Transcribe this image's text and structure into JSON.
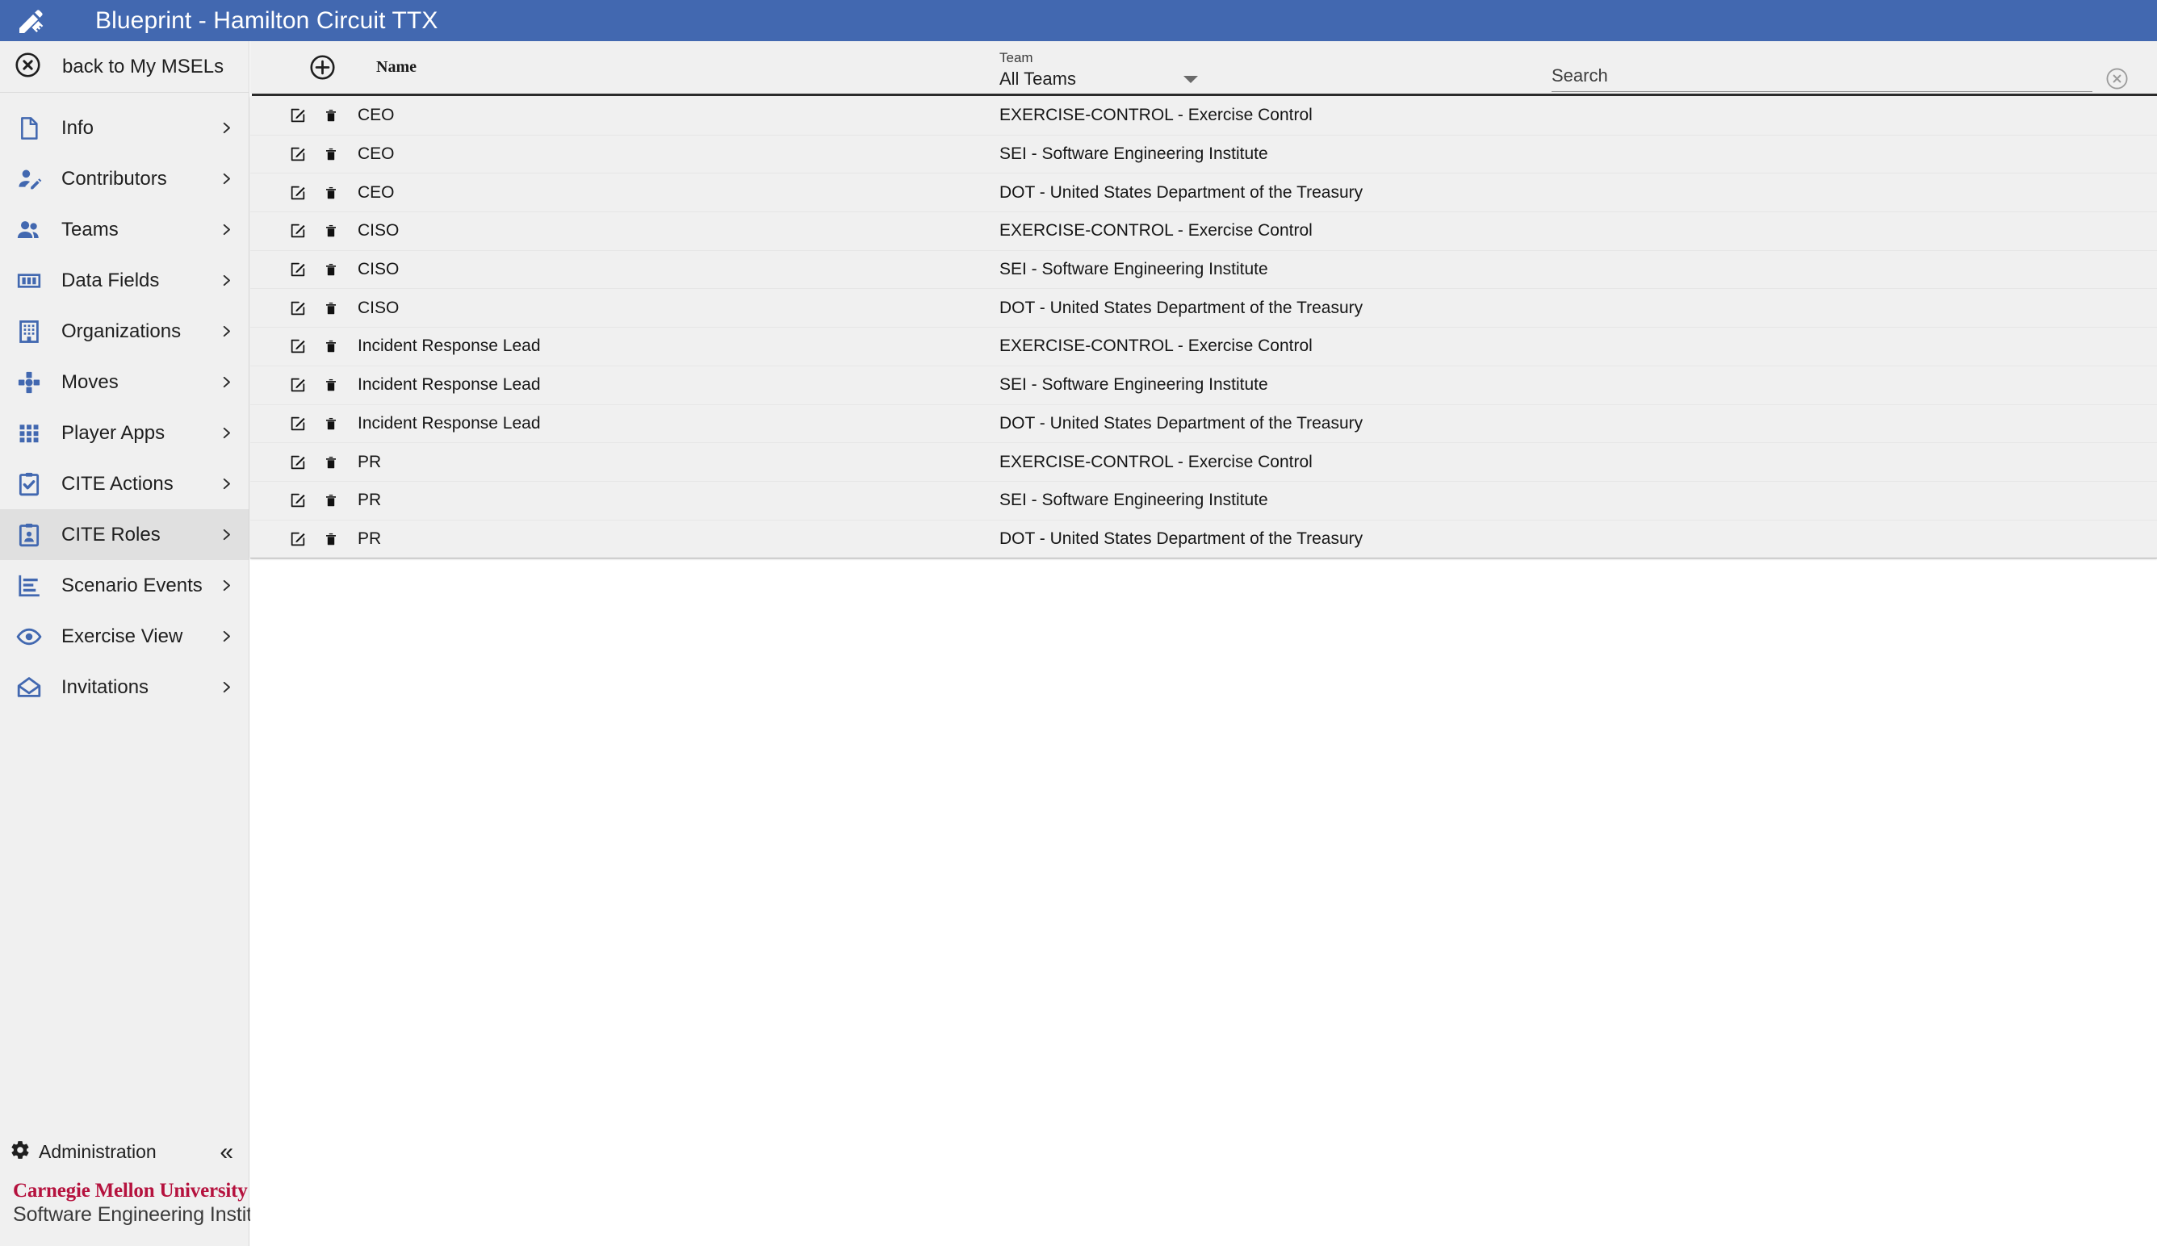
{
  "app": {
    "title": "Blueprint - Hamilton Circuit TTX",
    "logo_icon": "blueprint-pencil-ruler-icon",
    "accent_color": "#4268B0",
    "brand_color": "#B5123E"
  },
  "sidebar": {
    "back": {
      "label": "back to My MSELs",
      "icon": "circle-x-icon"
    },
    "items": [
      {
        "label": "Info",
        "icon": "document-icon",
        "selected": false
      },
      {
        "label": "Contributors",
        "icon": "user-edit-icon",
        "selected": false
      },
      {
        "label": "Teams",
        "icon": "people-icon",
        "selected": false
      },
      {
        "label": "Data Fields",
        "icon": "columns-icon",
        "selected": false
      },
      {
        "label": "Organizations",
        "icon": "building-icon",
        "selected": false
      },
      {
        "label": "Moves",
        "icon": "dpad-icon",
        "selected": false
      },
      {
        "label": "Player Apps",
        "icon": "grid-apps-icon",
        "selected": false
      },
      {
        "label": "CITE Actions",
        "icon": "clipboard-check-icon",
        "selected": false
      },
      {
        "label": "CITE Roles",
        "icon": "clipboard-user-icon",
        "selected": true
      },
      {
        "label": "Scenario Events",
        "icon": "gantt-chart-icon",
        "selected": false
      },
      {
        "label": "Exercise View",
        "icon": "eye-icon",
        "selected": false
      },
      {
        "label": "Invitations",
        "icon": "envelope-open-icon",
        "selected": false
      }
    ],
    "administration": {
      "label": "Administration",
      "icon": "gear-icon"
    },
    "collapse": {
      "icon": "double-chevron-left-icon",
      "glyph": "«"
    },
    "brand": {
      "line1": "Carnegie Mellon University",
      "line2": "Software Engineering Institute"
    }
  },
  "toolbar": {
    "add": {
      "icon": "circle-plus-icon",
      "label": "Add"
    },
    "name_column_header": "Name",
    "team_filter": {
      "label": "Team",
      "value": "All Teams",
      "icon": "chevron-down-icon"
    },
    "search": {
      "value": "",
      "placeholder": "Search",
      "clear_icon": "circle-x-icon"
    }
  },
  "table": {
    "columns": [
      "Name",
      "Team"
    ],
    "row_icons": {
      "edit": "edit-pencil-square-icon",
      "delete": "trash-icon"
    },
    "rows": [
      {
        "name": "CEO",
        "team": "EXERCISE-CONTROL - Exercise Control"
      },
      {
        "name": "CEO",
        "team": "SEI - Software Engineering Institute"
      },
      {
        "name": "CEO",
        "team": "DOT - United States Department of the Treasury"
      },
      {
        "name": "CISO",
        "team": "EXERCISE-CONTROL - Exercise Control"
      },
      {
        "name": "CISO",
        "team": "SEI - Software Engineering Institute"
      },
      {
        "name": "CISO",
        "team": "DOT - United States Department of the Treasury"
      },
      {
        "name": "Incident Response Lead",
        "team": "EXERCISE-CONTROL - Exercise Control"
      },
      {
        "name": "Incident Response Lead",
        "team": "SEI - Software Engineering Institute"
      },
      {
        "name": "Incident Response Lead",
        "team": "DOT - United States Department of the Treasury"
      },
      {
        "name": "PR",
        "team": "EXERCISE-CONTROL - Exercise Control"
      },
      {
        "name": "PR",
        "team": "SEI - Software Engineering Institute"
      },
      {
        "name": "PR",
        "team": "DOT - United States Department of the Treasury"
      }
    ]
  }
}
